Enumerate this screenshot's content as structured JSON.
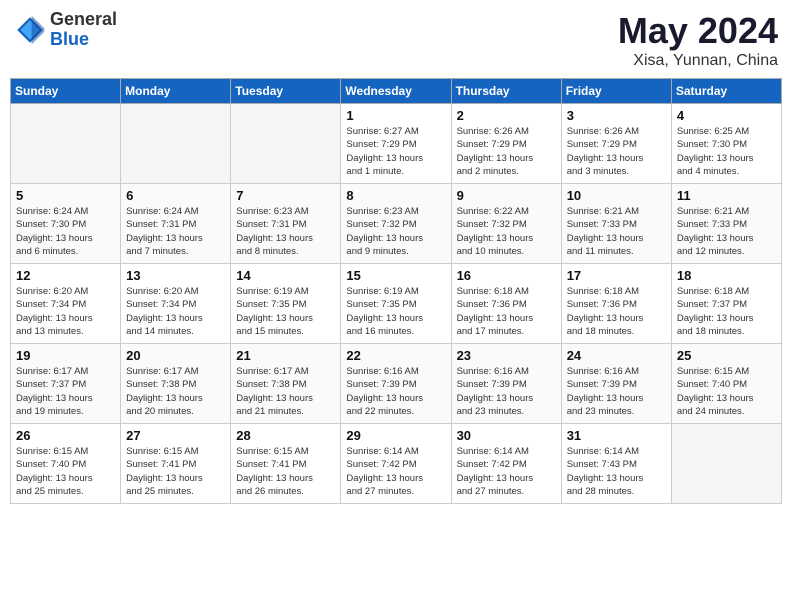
{
  "header": {
    "logo_general": "General",
    "logo_blue": "Blue",
    "month": "May 2024",
    "location": "Xisa, Yunnan, China"
  },
  "days_of_week": [
    "Sunday",
    "Monday",
    "Tuesday",
    "Wednesday",
    "Thursday",
    "Friday",
    "Saturday"
  ],
  "weeks": [
    [
      {
        "day": "",
        "info": ""
      },
      {
        "day": "",
        "info": ""
      },
      {
        "day": "",
        "info": ""
      },
      {
        "day": "1",
        "info": "Sunrise: 6:27 AM\nSunset: 7:29 PM\nDaylight: 13 hours\nand 1 minute."
      },
      {
        "day": "2",
        "info": "Sunrise: 6:26 AM\nSunset: 7:29 PM\nDaylight: 13 hours\nand 2 minutes."
      },
      {
        "day": "3",
        "info": "Sunrise: 6:26 AM\nSunset: 7:29 PM\nDaylight: 13 hours\nand 3 minutes."
      },
      {
        "day": "4",
        "info": "Sunrise: 6:25 AM\nSunset: 7:30 PM\nDaylight: 13 hours\nand 4 minutes."
      }
    ],
    [
      {
        "day": "5",
        "info": "Sunrise: 6:24 AM\nSunset: 7:30 PM\nDaylight: 13 hours\nand 6 minutes."
      },
      {
        "day": "6",
        "info": "Sunrise: 6:24 AM\nSunset: 7:31 PM\nDaylight: 13 hours\nand 7 minutes."
      },
      {
        "day": "7",
        "info": "Sunrise: 6:23 AM\nSunset: 7:31 PM\nDaylight: 13 hours\nand 8 minutes."
      },
      {
        "day": "8",
        "info": "Sunrise: 6:23 AM\nSunset: 7:32 PM\nDaylight: 13 hours\nand 9 minutes."
      },
      {
        "day": "9",
        "info": "Sunrise: 6:22 AM\nSunset: 7:32 PM\nDaylight: 13 hours\nand 10 minutes."
      },
      {
        "day": "10",
        "info": "Sunrise: 6:21 AM\nSunset: 7:33 PM\nDaylight: 13 hours\nand 11 minutes."
      },
      {
        "day": "11",
        "info": "Sunrise: 6:21 AM\nSunset: 7:33 PM\nDaylight: 13 hours\nand 12 minutes."
      }
    ],
    [
      {
        "day": "12",
        "info": "Sunrise: 6:20 AM\nSunset: 7:34 PM\nDaylight: 13 hours\nand 13 minutes."
      },
      {
        "day": "13",
        "info": "Sunrise: 6:20 AM\nSunset: 7:34 PM\nDaylight: 13 hours\nand 14 minutes."
      },
      {
        "day": "14",
        "info": "Sunrise: 6:19 AM\nSunset: 7:35 PM\nDaylight: 13 hours\nand 15 minutes."
      },
      {
        "day": "15",
        "info": "Sunrise: 6:19 AM\nSunset: 7:35 PM\nDaylight: 13 hours\nand 16 minutes."
      },
      {
        "day": "16",
        "info": "Sunrise: 6:18 AM\nSunset: 7:36 PM\nDaylight: 13 hours\nand 17 minutes."
      },
      {
        "day": "17",
        "info": "Sunrise: 6:18 AM\nSunset: 7:36 PM\nDaylight: 13 hours\nand 18 minutes."
      },
      {
        "day": "18",
        "info": "Sunrise: 6:18 AM\nSunset: 7:37 PM\nDaylight: 13 hours\nand 18 minutes."
      }
    ],
    [
      {
        "day": "19",
        "info": "Sunrise: 6:17 AM\nSunset: 7:37 PM\nDaylight: 13 hours\nand 19 minutes."
      },
      {
        "day": "20",
        "info": "Sunrise: 6:17 AM\nSunset: 7:38 PM\nDaylight: 13 hours\nand 20 minutes."
      },
      {
        "day": "21",
        "info": "Sunrise: 6:17 AM\nSunset: 7:38 PM\nDaylight: 13 hours\nand 21 minutes."
      },
      {
        "day": "22",
        "info": "Sunrise: 6:16 AM\nSunset: 7:39 PM\nDaylight: 13 hours\nand 22 minutes."
      },
      {
        "day": "23",
        "info": "Sunrise: 6:16 AM\nSunset: 7:39 PM\nDaylight: 13 hours\nand 23 minutes."
      },
      {
        "day": "24",
        "info": "Sunrise: 6:16 AM\nSunset: 7:39 PM\nDaylight: 13 hours\nand 23 minutes."
      },
      {
        "day": "25",
        "info": "Sunrise: 6:15 AM\nSunset: 7:40 PM\nDaylight: 13 hours\nand 24 minutes."
      }
    ],
    [
      {
        "day": "26",
        "info": "Sunrise: 6:15 AM\nSunset: 7:40 PM\nDaylight: 13 hours\nand 25 minutes."
      },
      {
        "day": "27",
        "info": "Sunrise: 6:15 AM\nSunset: 7:41 PM\nDaylight: 13 hours\nand 25 minutes."
      },
      {
        "day": "28",
        "info": "Sunrise: 6:15 AM\nSunset: 7:41 PM\nDaylight: 13 hours\nand 26 minutes."
      },
      {
        "day": "29",
        "info": "Sunrise: 6:14 AM\nSunset: 7:42 PM\nDaylight: 13 hours\nand 27 minutes."
      },
      {
        "day": "30",
        "info": "Sunrise: 6:14 AM\nSunset: 7:42 PM\nDaylight: 13 hours\nand 27 minutes."
      },
      {
        "day": "31",
        "info": "Sunrise: 6:14 AM\nSunset: 7:43 PM\nDaylight: 13 hours\nand 28 minutes."
      },
      {
        "day": "",
        "info": ""
      }
    ]
  ]
}
